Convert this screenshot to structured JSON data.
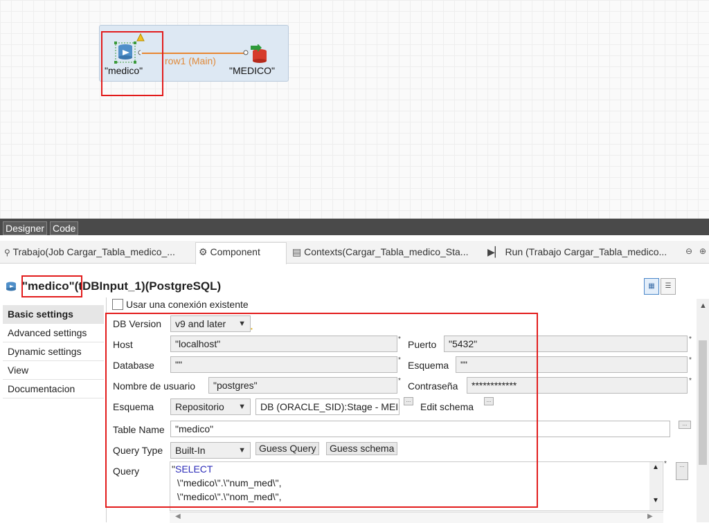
{
  "canvas": {
    "input_component": {
      "label": "\"medico\""
    },
    "output_component": {
      "label": "\"MEDICO\""
    },
    "link": {
      "label": "row1 (Main)"
    }
  },
  "designer_tabs": [
    {
      "label": "Designer"
    },
    {
      "label": "Code"
    }
  ],
  "view_tabs": [
    {
      "label": "Trabajo(Job Cargar_Tabla_medico_..."
    },
    {
      "label": "Component"
    },
    {
      "label": "Contexts(Cargar_Tabla_medico_Sta..."
    },
    {
      "label": "Run (Trabajo Cargar_Tabla_medico..."
    }
  ],
  "component_title": {
    "name": "\"medico\"",
    "rest": "(tDBInput_1)(PostgreSQL)"
  },
  "nav": [
    {
      "label": "Basic settings"
    },
    {
      "label": "Advanced settings"
    },
    {
      "label": "Dynamic settings"
    },
    {
      "label": "View"
    },
    {
      "label": "Documentacion"
    }
  ],
  "form": {
    "use_existing_connection": "Usar una conexión existente",
    "db_version": {
      "label": "DB Version",
      "value": "v9 and later"
    },
    "host": {
      "label": "Host",
      "value": "\"localhost\""
    },
    "port": {
      "label": "Puerto",
      "value": "\"5432\""
    },
    "database": {
      "label": "Database",
      "value": "\"\""
    },
    "schema_db": {
      "label": "Esquema",
      "value": "\"\""
    },
    "username": {
      "label": "Nombre de usuario",
      "value": "\"postgres\""
    },
    "password": {
      "label": "Contraseña",
      "value": "************"
    },
    "schema": {
      "label": "Esquema",
      "type_value": "Repositorio",
      "repo_value": "DB (ORACLE_SID):Stage - MEI",
      "edit_label": "Edit schema"
    },
    "table_name": {
      "label": "Table Name",
      "value": "\"medico\""
    },
    "query_type": {
      "label": "Query Type",
      "value": "Built-In"
    },
    "guess_query": "Guess Query",
    "guess_schema": "Guess schema",
    "query": {
      "label": "Query",
      "line1_quote": "\"",
      "line1_kw": "SELECT",
      "line2": " \\\"medico\\\".\\\"num_med\\\",",
      "line3": " \\\"medico\\\".\\\"nom_med\\\","
    },
    "mini_button": "...",
    "star": "*"
  },
  "colors": {
    "highlight_red": "#e21b1b",
    "link_orange": "#e8852f",
    "sql_keyword": "#2b2bb8"
  }
}
